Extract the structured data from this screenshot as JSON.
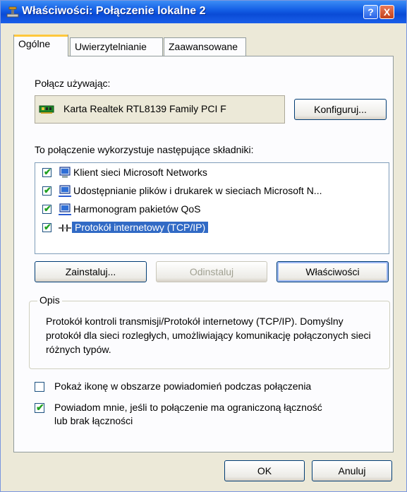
{
  "window": {
    "title": "Właściwości: Połączenie lokalne 2",
    "help_button": "?",
    "close_button": "X"
  },
  "tabs": [
    {
      "label": "Ogólne",
      "active": true
    },
    {
      "label": "Uwierzytelnianie",
      "active": false
    },
    {
      "label": "Zaawansowane",
      "active": false
    }
  ],
  "connect_using": {
    "label": "Połącz używając:",
    "adapter_name": "Karta Realtek RTL8139 Family PCI F",
    "configure_button": "Konfiguruj..."
  },
  "components": {
    "label": "To połączenie wykorzystuje następujące składniki:",
    "items": [
      {
        "label": "Klient sieci Microsoft Networks",
        "checked": true,
        "icon": "network-client-icon"
      },
      {
        "label": "Udostępnianie plików i drukarek w sieciach Microsoft N...",
        "checked": true,
        "icon": "file-printer-sharing-icon"
      },
      {
        "label": "Harmonogram pakietów QoS",
        "checked": true,
        "icon": "qos-scheduler-icon"
      },
      {
        "label": "Protokół internetowy (TCP/IP)",
        "checked": true,
        "selected": true,
        "icon": "protocol-icon"
      }
    ],
    "install_button": "Zainstaluj...",
    "uninstall_button": "Odinstaluj",
    "properties_button": "Właściwości"
  },
  "description": {
    "legend": "Opis",
    "text": "Protokół kontroli transmisji/Protokół internetowy (TCP/IP). Domyślny protokół dla sieci rozległych, umożliwiający komunikację połączonych sieci różnych typów."
  },
  "options": {
    "show_icon_label": "Pokaż ikonę w obszarze powiadomień podczas połączenia",
    "show_icon_checked": false,
    "notify_label_line1": "Powiadom mnie, jeśli to połączenie ma ograniczoną łączność",
    "notify_label_line2": "lub brak łączności",
    "notify_checked": true
  },
  "footer": {
    "ok_button": "OK",
    "cancel_button": "Anuluj"
  },
  "colors": {
    "titlebar": "#0a4bd6",
    "dialog_bg": "#ece9d8",
    "selection": "#316ac5"
  }
}
